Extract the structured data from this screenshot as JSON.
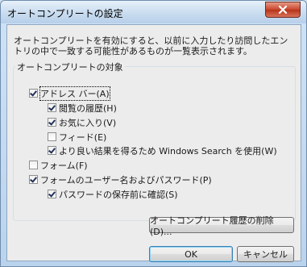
{
  "window": {
    "title": "オートコンプリートの設定"
  },
  "description": "オートコンプリートを有効にすると、以前に入力したり訪問したエントリの中で一致する可能性があるものが一覧表示されます。",
  "group": {
    "title": "オートコンプリートの対象",
    "items": [
      {
        "label": "アドレス バー(A)",
        "checked": true
      },
      {
        "label": "閲覧の履歴(H)",
        "checked": true
      },
      {
        "label": "お気に入り(V)",
        "checked": true
      },
      {
        "label": "フィード(E)",
        "checked": false
      },
      {
        "label": "より良い結果を得るため Windows Search を使用(W)",
        "checked": true
      },
      {
        "label": "フォーム(F)",
        "checked": false
      },
      {
        "label": "フォームのユーザー名およびパスワード(P)",
        "checked": true
      },
      {
        "label": "パスワードの保存前に確認(S)",
        "checked": true
      }
    ]
  },
  "buttons": {
    "delete_history": "オートコンプリート履歴の削除(D)...",
    "ok": "OK",
    "cancel": "キャンセル"
  }
}
